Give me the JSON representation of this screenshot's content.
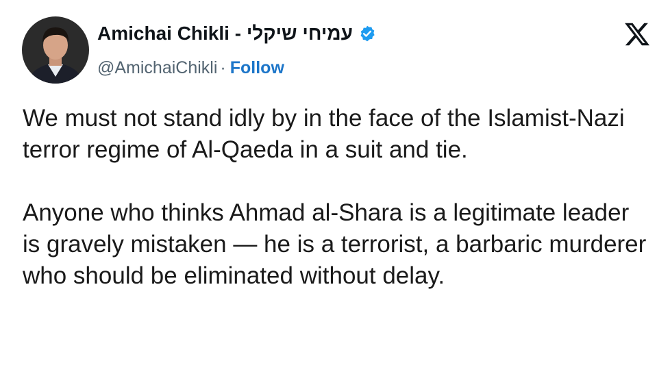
{
  "author": {
    "display_name": "Amichai Chikli - עמיחי שיקלי",
    "handle": "@AmichaiChikli",
    "separator": "·",
    "follow_label": "Follow",
    "verified_color": "#1d9bf0"
  },
  "icons": {
    "verified": "verified-badge-icon",
    "platform": "x-logo-icon"
  },
  "tweet": {
    "paragraph_1": "We must not stand idly by in the face of the Islamist-Nazi terror regime of Al-Qaeda in a suit and tie.",
    "paragraph_2": "Anyone who thinks Ahmad al-Shara is a legitimate leader is gravely mistaken — he is a terrorist, a barbaric murderer who should be eliminated without delay."
  },
  "colors": {
    "text": "#0f1419",
    "secondary": "#536471",
    "link": "#1d76c9"
  }
}
